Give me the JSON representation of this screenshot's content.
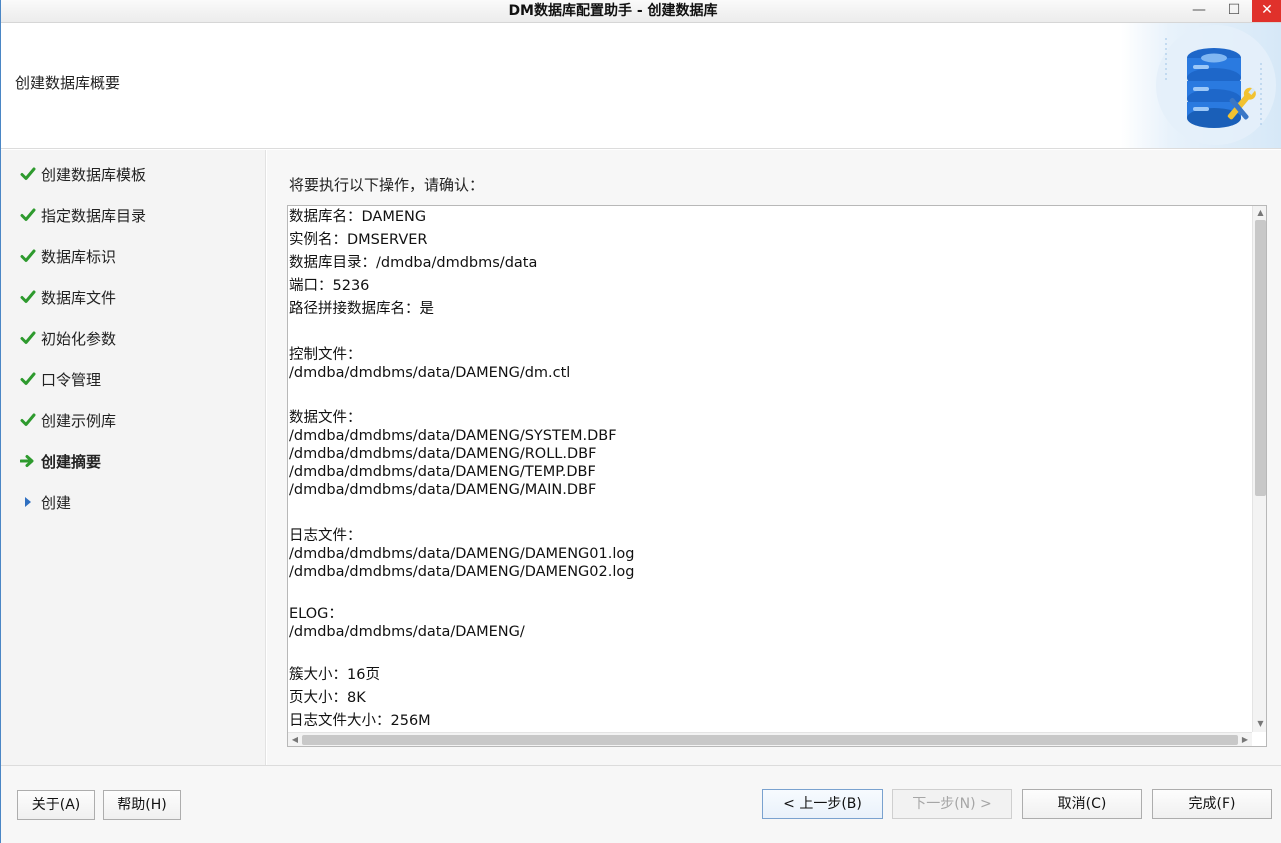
{
  "window": {
    "title": "DM数据库配置助手 - 创建数据库",
    "minimize_glyph": "—",
    "maximize_glyph": "☐",
    "close_glyph": "✕"
  },
  "header": {
    "title": "创建数据库概要",
    "art_icon": "database-wrench-icon"
  },
  "sidebar": {
    "steps": [
      {
        "label": "创建数据库模板",
        "status": "done"
      },
      {
        "label": "指定数据库目录",
        "status": "done"
      },
      {
        "label": "数据库标识",
        "status": "done"
      },
      {
        "label": "数据库文件",
        "status": "done"
      },
      {
        "label": "初始化参数",
        "status": "done"
      },
      {
        "label": "口令管理",
        "status": "done"
      },
      {
        "label": "创建示例库",
        "status": "done"
      },
      {
        "label": "创建摘要",
        "status": "current"
      },
      {
        "label": "创建",
        "status": "pending"
      }
    ]
  },
  "content": {
    "prompt": "将要执行以下操作，请确认：",
    "summary_lines": [
      "数据库名：DAMENG",
      "实例名：DMSERVER",
      "数据库目录：/dmdba/dmdbms/data",
      "端口：5236",
      "路径拼接数据库名：是",
      "",
      "控制文件：",
      "/dmdba/dmdbms/data/DAMENG/dm.ctl",
      "",
      "数据文件：",
      "/dmdba/dmdbms/data/DAMENG/SYSTEM.DBF",
      "/dmdba/dmdbms/data/DAMENG/ROLL.DBF",
      "/dmdba/dmdbms/data/DAMENG/TEMP.DBF",
      "/dmdba/dmdbms/data/DAMENG/MAIN.DBF",
      "",
      "日志文件：",
      "/dmdba/dmdbms/data/DAMENG/DAMENG01.log",
      "/dmdba/dmdbms/data/DAMENG/DAMENG02.log",
      "",
      "ELOG：",
      "/dmdba/dmdbms/data/DAMENG/",
      "",
      "簇大小：16页",
      "页大小：8K",
      "日志文件大小：256M"
    ]
  },
  "footer": {
    "about_label": "关于(A)",
    "help_label": "帮助(H)",
    "back_label": "< 上一步(B)",
    "next_label": "下一步(N) >",
    "cancel_label": "取消(C)",
    "finish_label": "完成(F)"
  },
  "colors": {
    "check": "#2e9a2e",
    "arrow_current": "#2e9a2e",
    "arrow_pending": "#2f6fc0",
    "close_button": "#e0312b"
  }
}
